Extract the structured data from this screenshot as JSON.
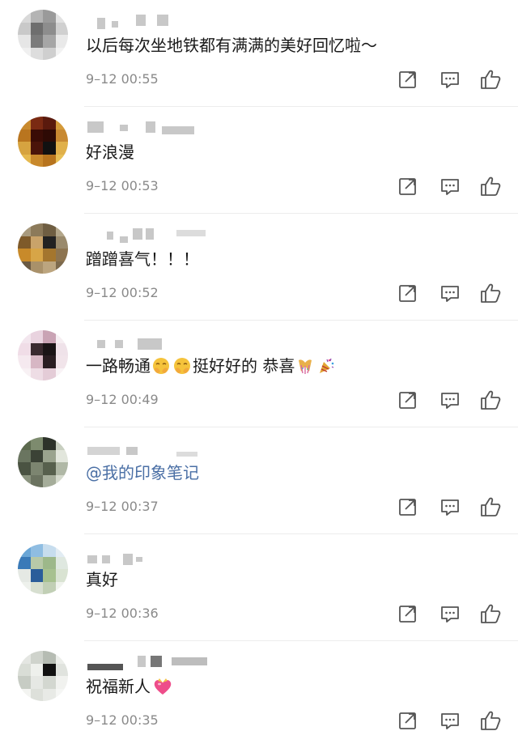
{
  "comments": [
    {
      "text": "以后每次坐地铁都有满满的美好回忆啦～",
      "time": "9–12 00:55"
    },
    {
      "text": "好浪漫",
      "time": "9–12 00:53"
    },
    {
      "text": "蹭蹭喜气！！！",
      "time": "9–12 00:52"
    },
    {
      "text_a": "一路畅通",
      "text_b": "挺好好的  恭喜",
      "time": "9–12 00:49"
    },
    {
      "mention": "@我的印象笔记",
      "time": "9–12 00:37"
    },
    {
      "text": "真好",
      "time": "9–12 00:36"
    },
    {
      "text": "祝福新人",
      "time": "9–12 00:35"
    }
  ],
  "icons": {
    "share": "share-icon",
    "reply": "comment-icon",
    "like": "thumbs-up-icon"
  },
  "colors": {
    "text": "#1a1a1a",
    "time": "#8a8a8a",
    "mention": "#4a6fa5",
    "icon": "#555555",
    "divider": "#ececec"
  }
}
